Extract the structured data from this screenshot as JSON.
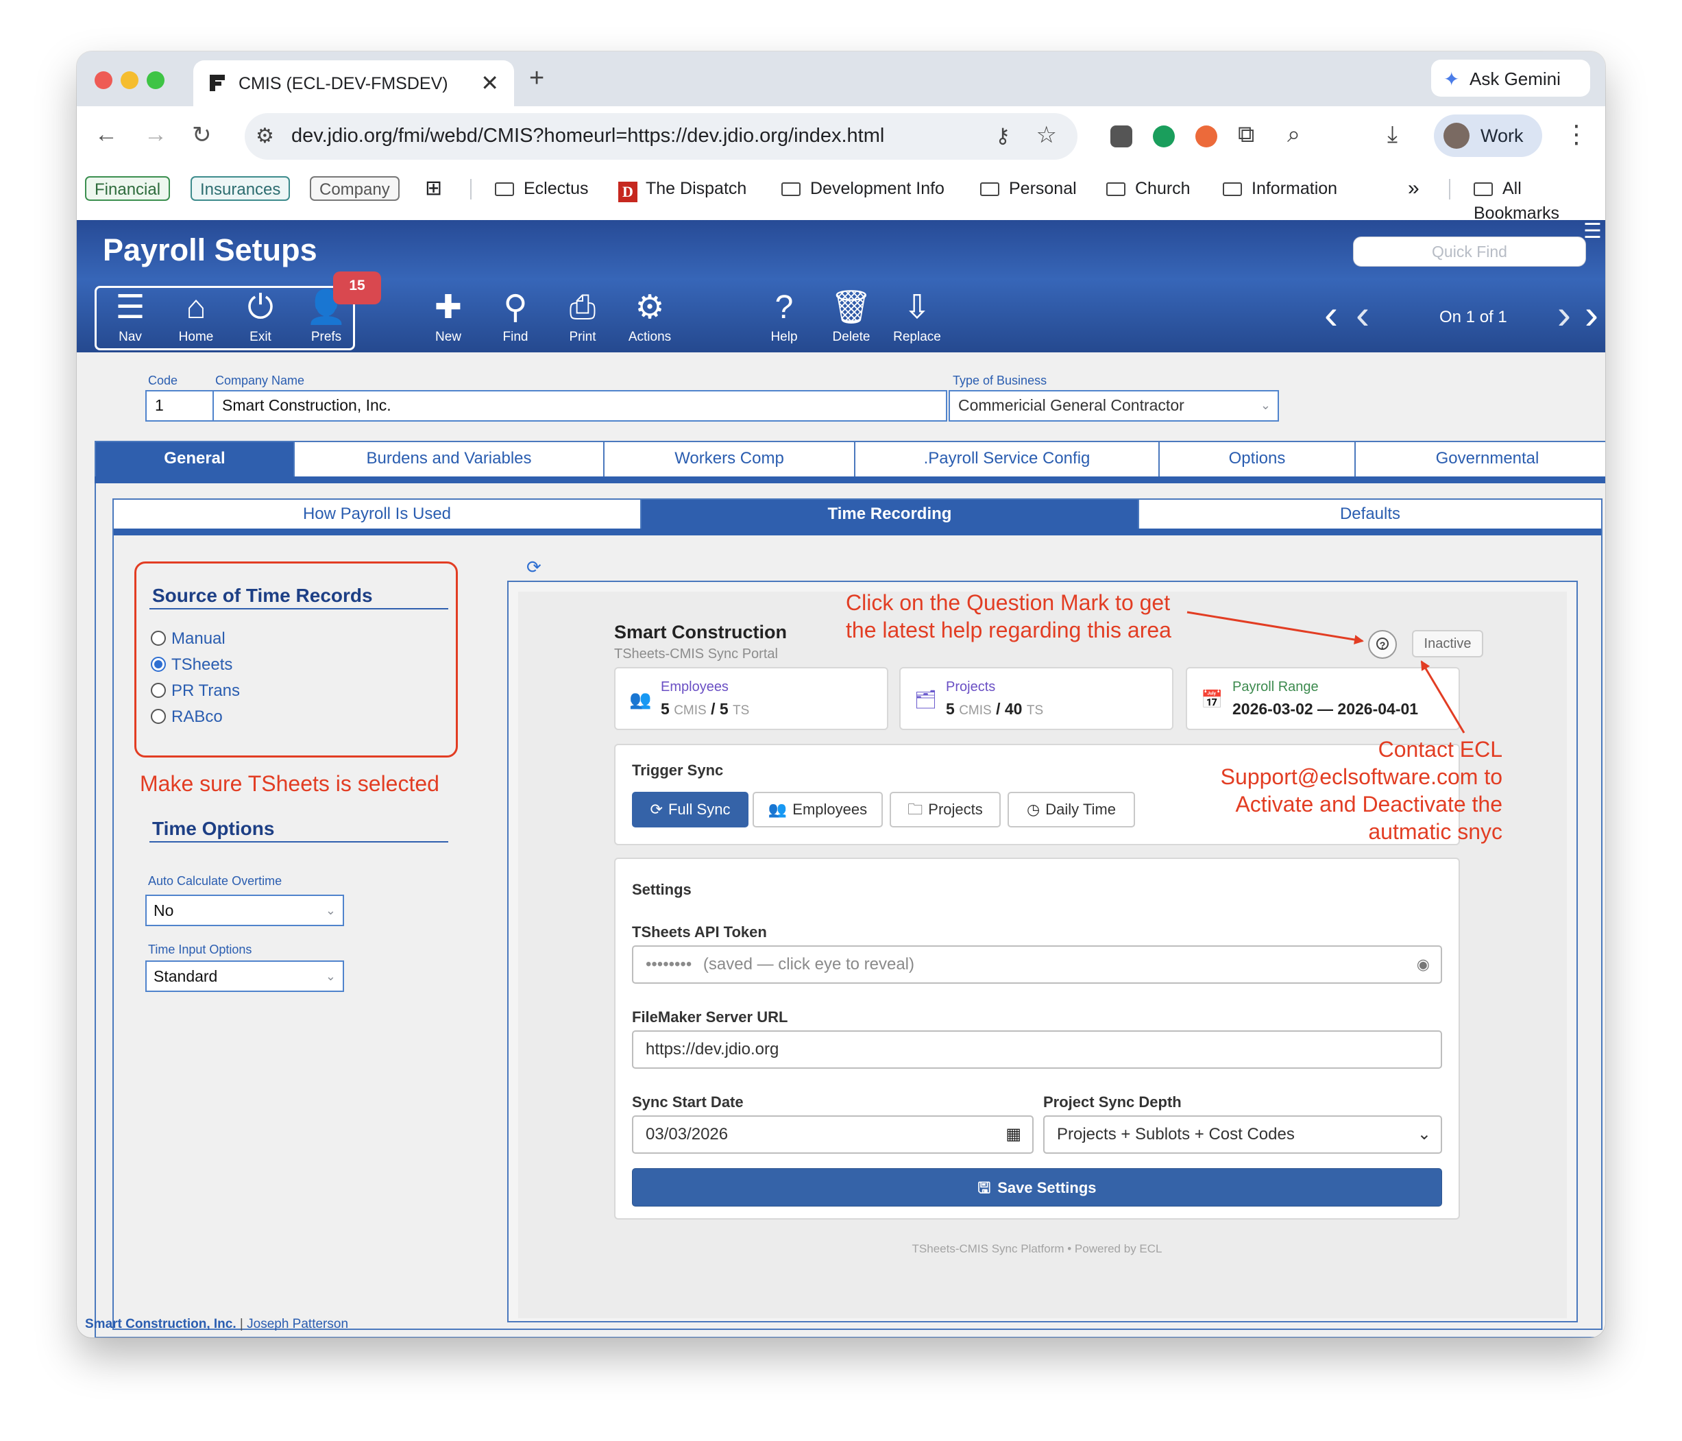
{
  "browser": {
    "tab_title": "CMIS (ECL-DEV-FMSDEV)",
    "tab_close": "✕",
    "new_tab": "+",
    "gemini_label": "Ask Gemini",
    "url": "dev.jdio.org/fmi/webd/CMIS?homeurl=https://dev.jdio.org/index.html",
    "profile_label": "Work",
    "bookmarks_chips": [
      "Financial",
      "Insurances",
      "Company"
    ],
    "bookmarks": [
      "Eclectus",
      "The Dispatch",
      "Development Info",
      "Personal",
      "Church",
      "Information"
    ],
    "bookmarks_more": "»",
    "all_bookmarks": "All Bookmarks"
  },
  "header": {
    "title": "Payroll Setups",
    "quick_find_placeholder": "Quick Find",
    "badge": "15",
    "nav_group": [
      {
        "label": "Nav",
        "icon": "menu-icon"
      },
      {
        "label": "Home",
        "icon": "home-icon"
      },
      {
        "label": "Exit",
        "icon": "power-icon"
      },
      {
        "label": "Prefs",
        "icon": "user-icon"
      }
    ],
    "actions": [
      {
        "label": "New",
        "icon": "plus-icon"
      },
      {
        "label": "Find",
        "icon": "search-icon"
      },
      {
        "label": "Print",
        "icon": "printer-icon"
      },
      {
        "label": "Actions",
        "icon": "gear-icon"
      },
      {
        "label": "Help",
        "icon": "help-icon"
      },
      {
        "label": "Delete",
        "icon": "trash-icon"
      },
      {
        "label": "Replace",
        "icon": "download-icon"
      }
    ],
    "record_nav": "On 1 of 1"
  },
  "record": {
    "code_label": "Code",
    "code": "1",
    "company_label": "Company Name",
    "company": "Smart Construction, Inc.",
    "business_label": "Type of Business",
    "business": "Commericial General Contractor"
  },
  "main_tabs": [
    "General",
    "Burdens and Variables",
    "Workers Comp",
    ".Payroll Service Config",
    "Options",
    "Governmental"
  ],
  "sub_tabs": [
    "How Payroll Is Used",
    "Time Recording",
    "Defaults"
  ],
  "left": {
    "source_heading": "Source of Time Records",
    "sources": [
      "Manual",
      "TSheets",
      "PR Trans",
      "RABco"
    ],
    "selected_source": "TSheets",
    "note": "Make sure TSheets is selected",
    "time_options_heading": "Time Options",
    "overtime_label": "Auto Calculate Overtime",
    "overtime_value": "No",
    "time_input_label": "Time Input Options",
    "time_input_value": "Standard"
  },
  "sync": {
    "company": "Smart Construction",
    "subtitle": "TSheets-CMIS Sync Portal",
    "status": "Inactive",
    "help_glyph": "?",
    "cards": [
      {
        "label": "Employees",
        "a": "5",
        "a_unit": "CMIS",
        "sep": "/",
        "b": "5",
        "b_unit": "TS"
      },
      {
        "label": "Projects",
        "a": "5",
        "a_unit": "CMIS",
        "sep": "/",
        "b": "40",
        "b_unit": "TS"
      },
      {
        "label": "Payroll Range",
        "value": "2026-03-02 — 2026-04-01"
      }
    ],
    "trigger_heading": "Trigger Sync",
    "trigger_buttons": [
      "Full Sync",
      "Employees",
      "Projects",
      "Daily Time"
    ],
    "settings_heading": "Settings",
    "token_label": "TSheets API Token",
    "token_dots": "••••••••",
    "token_placeholder": "(saved — click eye to reveal)",
    "server_label": "FileMaker Server URL",
    "server_value": "https://dev.jdio.org",
    "start_label": "Sync Start Date",
    "start_value": "03/03/2026",
    "depth_label": "Project Sync Depth",
    "depth_value": "Projects + Sublots + Cost Codes",
    "save_label": "Save Settings",
    "powered": "TSheets-CMIS Sync Platform • Powered by ECL"
  },
  "annotations": {
    "help_note_1": "Click on the Question Mark to get",
    "help_note_2": "the latest help regarding this area",
    "contact_1": "Contact ECL",
    "contact_2": "Support@eclsoftware.com to",
    "contact_3": "Activate and Deactivate the",
    "contact_4": "autmatic snyc"
  },
  "footer": {
    "company": "Smart Construction, Inc.",
    "separator": "|",
    "user": "Joseph Patterson"
  },
  "colors": {
    "fm_blue": "#2f5fae",
    "annotation_red": "#e23d23",
    "save_button": "#3563a8",
    "badge_red": "#d9484f"
  }
}
